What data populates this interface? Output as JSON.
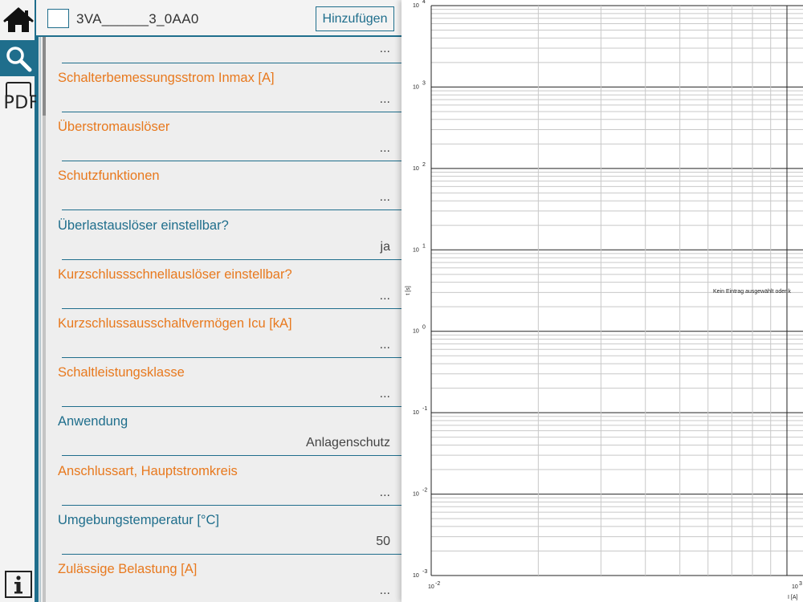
{
  "header": {
    "product_code": "3VA______3_0AA0",
    "add_button": "Hinzufügen"
  },
  "rail": {
    "pdf_label": "PDF",
    "items": [
      "home-icon",
      "search-icon",
      "pdf-icon",
      "info-icon"
    ]
  },
  "list": {
    "first_value": "...",
    "rows": [
      {
        "label": "Schalterbemessungsstrom Inmax [A]",
        "value": "...",
        "color": "orange"
      },
      {
        "label": "Überstromauslöser",
        "value": "...",
        "color": "orange"
      },
      {
        "label": "Schutzfunktionen",
        "value": "...",
        "color": "orange"
      },
      {
        "label": "Überlastauslöser einstellbar?",
        "value": "ja",
        "color": "teal"
      },
      {
        "label": "Kurzschlussschnellauslöser einstellbar?",
        "value": "...",
        "color": "orange"
      },
      {
        "label": "Kurzschlussausschaltvermögen Icu [kA]",
        "value": "...",
        "color": "orange"
      },
      {
        "label": "Schaltleistungsklasse",
        "value": "...",
        "color": "orange"
      },
      {
        "label": "Anwendung",
        "value": "Anlagenschutz",
        "color": "teal"
      },
      {
        "label": "Anschlussart, Hauptstromkreis",
        "value": "...",
        "color": "orange"
      },
      {
        "label": "Umgebungstemperatur [°C]",
        "value": "50",
        "color": "teal"
      },
      {
        "label": "Zulässige Belastung [A]",
        "value": "...",
        "color": "orange"
      }
    ]
  },
  "colors": {
    "accent": "#1f6e8c",
    "orange_label": "#e8791e",
    "list_background": "#eeeeee"
  },
  "chart_data": {
    "type": "line",
    "x_scale": "log",
    "y_scale": "log",
    "xlim": [
      0.01,
      1000
    ],
    "ylim": [
      0.001,
      10000
    ],
    "x_ticks": [
      {
        "base": "10",
        "exp": "-2"
      },
      {
        "base": "10",
        "exp": "3"
      }
    ],
    "y_ticks": [
      {
        "base": "10",
        "exp": "4"
      },
      {
        "base": "10",
        "exp": "3"
      },
      {
        "base": "10",
        "exp": "2"
      },
      {
        "base": "10",
        "exp": "1"
      },
      {
        "base": "10",
        "exp": "0"
      },
      {
        "base": "10",
        "exp": "-1"
      },
      {
        "base": "10",
        "exp": "-2"
      },
      {
        "base": "10",
        "exp": "-3"
      }
    ],
    "xlabel": "I [A]",
    "ylabel": "t [s]",
    "grid": true,
    "series": [],
    "annotation": "Kein Eintrag ausgewählt oder k"
  }
}
